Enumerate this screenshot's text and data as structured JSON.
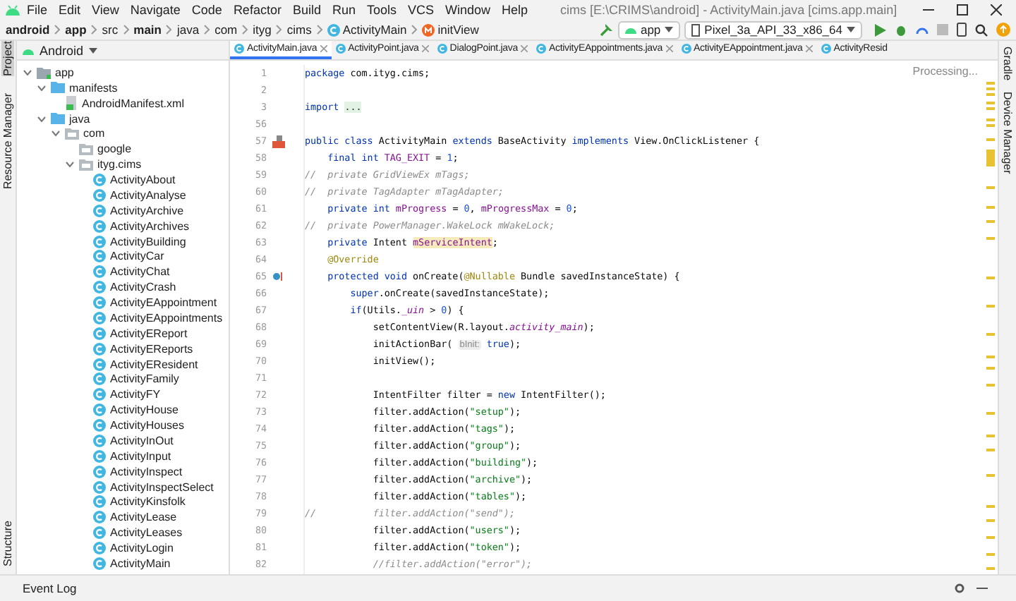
{
  "window": {
    "title": "cims [E:\\CRIMS\\android] - ActivityMain.java [cims.app.main]"
  },
  "menu": [
    "File",
    "Edit",
    "View",
    "Navigate",
    "Code",
    "Refactor",
    "Build",
    "Run",
    "Tools",
    "VCS",
    "Window",
    "Help"
  ],
  "breadcrumbs": [
    {
      "label": "android",
      "kind": "root"
    },
    {
      "label": "app",
      "kind": "root"
    },
    {
      "label": "src",
      "kind": "dir"
    },
    {
      "label": "main",
      "kind": "root"
    },
    {
      "label": "java",
      "kind": "dir"
    },
    {
      "label": "com",
      "kind": "dir"
    },
    {
      "label": "ityg",
      "kind": "dir"
    },
    {
      "label": "cims",
      "kind": "dir"
    },
    {
      "label": "ActivityMain",
      "kind": "class"
    },
    {
      "label": "initView",
      "kind": "method"
    }
  ],
  "run_config": {
    "module": "app",
    "device": "Pixel_3a_API_33_x86_64"
  },
  "left_strip": [
    {
      "label": "Project",
      "selected": true
    },
    {
      "label": "Resource Manager",
      "selected": false
    },
    {
      "label": "Structure",
      "selected": false
    }
  ],
  "right_strip": [
    "Gradle",
    "Device Manager"
  ],
  "project": {
    "view": "Android",
    "tree": [
      {
        "label": "app",
        "kind": "module",
        "expanded": true,
        "children": [
          {
            "label": "manifests",
            "kind": "folder",
            "expanded": true,
            "children": [
              {
                "label": "AndroidManifest.xml",
                "kind": "manifest"
              }
            ]
          },
          {
            "label": "java",
            "kind": "folder",
            "expanded": true,
            "children": [
              {
                "label": "com",
                "kind": "package",
                "expanded": true,
                "children": [
                  {
                    "label": "google",
                    "kind": "package"
                  },
                  {
                    "label": "ityg.cims",
                    "kind": "package",
                    "expanded": true,
                    "children": [
                      {
                        "label": "ActivityAbout",
                        "kind": "class"
                      },
                      {
                        "label": "ActivityAnalyse",
                        "kind": "class"
                      },
                      {
                        "label": "ActivityArchive",
                        "kind": "class"
                      },
                      {
                        "label": "ActivityArchives",
                        "kind": "class"
                      },
                      {
                        "label": "ActivityBuilding",
                        "kind": "class"
                      },
                      {
                        "label": "ActivityCar",
                        "kind": "class"
                      },
                      {
                        "label": "ActivityChat",
                        "kind": "class"
                      },
                      {
                        "label": "ActivityCrash",
                        "kind": "class"
                      },
                      {
                        "label": "ActivityEAppointment",
                        "kind": "class"
                      },
                      {
                        "label": "ActivityEAppointments",
                        "kind": "class"
                      },
                      {
                        "label": "ActivityEReport",
                        "kind": "class"
                      },
                      {
                        "label": "ActivityEReports",
                        "kind": "class"
                      },
                      {
                        "label": "ActivityEResident",
                        "kind": "class"
                      },
                      {
                        "label": "ActivityFamily",
                        "kind": "class"
                      },
                      {
                        "label": "ActivityFY",
                        "kind": "class"
                      },
                      {
                        "label": "ActivityHouse",
                        "kind": "class"
                      },
                      {
                        "label": "ActivityHouses",
                        "kind": "class"
                      },
                      {
                        "label": "ActivityInOut",
                        "kind": "class"
                      },
                      {
                        "label": "ActivityInput",
                        "kind": "class"
                      },
                      {
                        "label": "ActivityInspect",
                        "kind": "class"
                      },
                      {
                        "label": "ActivityInspectSelect",
                        "kind": "class"
                      },
                      {
                        "label": "ActivityKinsfolk",
                        "kind": "class"
                      },
                      {
                        "label": "ActivityLease",
                        "kind": "class"
                      },
                      {
                        "label": "ActivityLeases",
                        "kind": "class"
                      },
                      {
                        "label": "ActivityLogin",
                        "kind": "class"
                      },
                      {
                        "label": "ActivityMain",
                        "kind": "class"
                      }
                    ]
                  }
                ]
              }
            ]
          }
        ]
      }
    ]
  },
  "tabs": [
    {
      "label": "ActivityMain.java",
      "selected": true
    },
    {
      "label": "ActivityPoint.java",
      "selected": false
    },
    {
      "label": "DialogPoint.java",
      "selected": false
    },
    {
      "label": "ActivityEAppointments.java",
      "selected": false
    },
    {
      "label": "ActivityEAppointment.java",
      "selected": false
    },
    {
      "label": "ActivityResid",
      "selected": false
    }
  ],
  "status_hint": "Processing...",
  "code": [
    {
      "number": "1",
      "tokens": [
        {
          "kind": "keyword",
          "text": "package "
        },
        {
          "kind": "plain",
          "text": "com.ityg.cims;"
        }
      ]
    },
    {
      "number": "2"
    },
    {
      "number": "3",
      "tokens": [
        {
          "kind": "keyword",
          "text": "import "
        },
        {
          "kind": "fold",
          "text": "..."
        }
      ]
    },
    {
      "number": "56"
    },
    {
      "number": "57",
      "gutter": {
        "kind": "implemented"
      },
      "tokens": [
        {
          "kind": "keyword",
          "text": "public class "
        },
        {
          "kind": "plain",
          "text": "ActivityMain "
        },
        {
          "kind": "keyword",
          "text": "extends "
        },
        {
          "kind": "plain",
          "text": "BaseActivity "
        },
        {
          "kind": "keyword",
          "text": "implements "
        },
        {
          "kind": "plain",
          "text": "View.OnClickListener {"
        }
      ]
    },
    {
      "number": "58",
      "tokens": [
        {
          "kind": "keyword",
          "text": "    final int "
        },
        {
          "kind": "field",
          "text": "TAG_EXIT"
        },
        {
          "kind": "plain",
          "text": " = "
        },
        {
          "kind": "number",
          "text": "1"
        },
        {
          "kind": "plain",
          "text": ";"
        }
      ]
    },
    {
      "number": "59",
      "tokens": [
        {
          "kind": "comment",
          "text": "//  private GridViewEx mTags;"
        }
      ]
    },
    {
      "number": "60",
      "tokens": [
        {
          "kind": "comment",
          "text": "//  private TagAdapter mTagAdapter;"
        }
      ]
    },
    {
      "number": "61",
      "tokens": [
        {
          "kind": "keyword",
          "text": "    private int "
        },
        {
          "kind": "field",
          "text": "mProgress"
        },
        {
          "kind": "plain",
          "text": " = "
        },
        {
          "kind": "number",
          "text": "0"
        },
        {
          "kind": "plain",
          "text": ", "
        },
        {
          "kind": "field",
          "text": "mProgressMax"
        },
        {
          "kind": "plain",
          "text": " = "
        },
        {
          "kind": "number",
          "text": "0"
        },
        {
          "kind": "plain",
          "text": ";"
        }
      ]
    },
    {
      "number": "62",
      "tokens": [
        {
          "kind": "comment",
          "text": "//  private PowerManager.WakeLock mWakeLock;"
        }
      ]
    },
    {
      "number": "63",
      "tokens": [
        {
          "kind": "keyword",
          "text": "    private "
        },
        {
          "kind": "plain",
          "text": "Intent "
        },
        {
          "kind": "highlight",
          "text": "mServiceIntent"
        },
        {
          "kind": "plain",
          "text": ";"
        }
      ]
    },
    {
      "number": "64",
      "tokens": [
        {
          "kind": "annotation",
          "text": "    @Override"
        }
      ]
    },
    {
      "number": "65",
      "gutter": {
        "kind": "override"
      },
      "tokens": [
        {
          "kind": "keyword",
          "text": "    protected void "
        },
        {
          "kind": "plain",
          "text": "onCreate("
        },
        {
          "kind": "annotation",
          "text": "@Nullable "
        },
        {
          "kind": "plain",
          "text": "Bundle savedInstanceState) {"
        }
      ]
    },
    {
      "number": "66",
      "tokens": [
        {
          "kind": "keyword",
          "text": "        super"
        },
        {
          "kind": "plain",
          "text": ".onCreate(savedInstanceState);"
        }
      ]
    },
    {
      "number": "67",
      "tokens": [
        {
          "kind": "keyword",
          "text": "        if"
        },
        {
          "kind": "plain",
          "text": "(Utils."
        },
        {
          "kind": "static",
          "text": "_uin"
        },
        {
          "kind": "plain",
          "text": " > "
        },
        {
          "kind": "number",
          "text": "0"
        },
        {
          "kind": "plain",
          "text": ") {"
        }
      ]
    },
    {
      "number": "68",
      "tokens": [
        {
          "kind": "plain",
          "text": "            setContentView(R.layout."
        },
        {
          "kind": "static",
          "text": "activity_main"
        },
        {
          "kind": "plain",
          "text": ");"
        }
      ]
    },
    {
      "number": "69",
      "tokens": [
        {
          "kind": "plain",
          "text": "            initActionBar( "
        },
        {
          "kind": "hint",
          "text": "bInit:"
        },
        {
          "kind": "keyword",
          "text": " true"
        },
        {
          "kind": "plain",
          "text": ");"
        }
      ]
    },
    {
      "number": "70",
      "tokens": [
        {
          "kind": "plain",
          "text": "            initView();"
        }
      ]
    },
    {
      "number": "71"
    },
    {
      "number": "72",
      "tokens": [
        {
          "kind": "plain",
          "text": "            IntentFilter filter = "
        },
        {
          "kind": "keyword",
          "text": "new "
        },
        {
          "kind": "plain",
          "text": "IntentFilter();"
        }
      ]
    },
    {
      "number": "73",
      "tokens": [
        {
          "kind": "plain",
          "text": "            filter.addAction("
        },
        {
          "kind": "string",
          "text": "\"setup\""
        },
        {
          "kind": "plain",
          "text": ");"
        }
      ]
    },
    {
      "number": "74",
      "tokens": [
        {
          "kind": "plain",
          "text": "            filter.addAction("
        },
        {
          "kind": "string",
          "text": "\"tags\""
        },
        {
          "kind": "plain",
          "text": ");"
        }
      ]
    },
    {
      "number": "75",
      "tokens": [
        {
          "kind": "plain",
          "text": "            filter.addAction("
        },
        {
          "kind": "string",
          "text": "\"group\""
        },
        {
          "kind": "plain",
          "text": ");"
        }
      ]
    },
    {
      "number": "76",
      "tokens": [
        {
          "kind": "plain",
          "text": "            filter.addAction("
        },
        {
          "kind": "string",
          "text": "\"building\""
        },
        {
          "kind": "plain",
          "text": ");"
        }
      ]
    },
    {
      "number": "77",
      "tokens": [
        {
          "kind": "plain",
          "text": "            filter.addAction("
        },
        {
          "kind": "string",
          "text": "\"archive\""
        },
        {
          "kind": "plain",
          "text": ");"
        }
      ]
    },
    {
      "number": "78",
      "tokens": [
        {
          "kind": "plain",
          "text": "            filter.addAction("
        },
        {
          "kind": "string",
          "text": "\"tables\""
        },
        {
          "kind": "plain",
          "text": ");"
        }
      ]
    },
    {
      "number": "79",
      "tokens": [
        {
          "kind": "comment",
          "text": "//          filter.addAction(\"send\");"
        }
      ]
    },
    {
      "number": "80",
      "tokens": [
        {
          "kind": "plain",
          "text": "            filter.addAction("
        },
        {
          "kind": "string",
          "text": "\"users\""
        },
        {
          "kind": "plain",
          "text": ");"
        }
      ]
    },
    {
      "number": "81",
      "tokens": [
        {
          "kind": "plain",
          "text": "            filter.addAction("
        },
        {
          "kind": "string",
          "text": "\"token\""
        },
        {
          "kind": "plain",
          "text": ");"
        }
      ]
    },
    {
      "number": "82",
      "tokens": [
        {
          "kind": "comment",
          "text": "            //filter.addAction(\"error\");"
        }
      ]
    }
  ],
  "bottom_bar": {
    "label": "Event Log"
  }
}
